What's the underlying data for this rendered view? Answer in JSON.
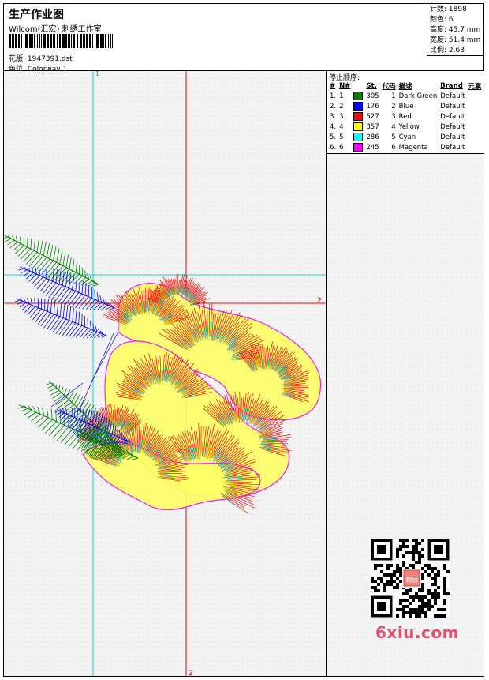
{
  "header": {
    "title": "生产作业图",
    "company": "Wilcom(汇宏) 刺绣工作室",
    "design_label": "花版: 1947391.dst",
    "colorway_label": "色位: Colorway 1"
  },
  "stats": {
    "stitches": "针数: 1898",
    "colors": "颜色: 6",
    "height": "高度: 45.7 mm",
    "width": "宽度: 51.4 mm",
    "scale": "比例: 2.63"
  },
  "canvas": {
    "cyan_axis_label": "1",
    "red_axis_label_right": "2",
    "red_axis_label_bottom": "2"
  },
  "stop_sequence": {
    "title": "停止顺序:",
    "columns": [
      "#",
      "N#",
      "St.",
      "代码",
      "描述",
      "Brand",
      "元素"
    ],
    "rows": [
      {
        "num": "1.",
        "needle": "1",
        "color": "#008000",
        "stitches": "305",
        "code": "1",
        "desc": "Dark Green",
        "brand": "Default"
      },
      {
        "num": "2.",
        "needle": "2",
        "color": "#0000ff",
        "stitches": "176",
        "code": "2",
        "desc": "Blue",
        "brand": "Default"
      },
      {
        "num": "3.",
        "needle": "3",
        "color": "#ff0000",
        "stitches": "527",
        "code": "3",
        "desc": "Red",
        "brand": "Default"
      },
      {
        "num": "4.",
        "needle": "4",
        "color": "#ffff00",
        "stitches": "357",
        "code": "4",
        "desc": "Yellow",
        "brand": "Default"
      },
      {
        "num": "5.",
        "needle": "5",
        "color": "#00ffff",
        "stitches": "286",
        "code": "5",
        "desc": "Cyan",
        "brand": "Default"
      },
      {
        "num": "6.",
        "needle": "6",
        "color": "#ff00ff",
        "stitches": "245",
        "code": "6",
        "desc": "Magenta",
        "brand": "Default"
      }
    ]
  },
  "watermark": {
    "brand_text": "6xiu.com",
    "qr_center_text": "刺绣"
  },
  "icons": {
    "barcode": "barcode-icon",
    "qr": "qr-code-icon"
  }
}
